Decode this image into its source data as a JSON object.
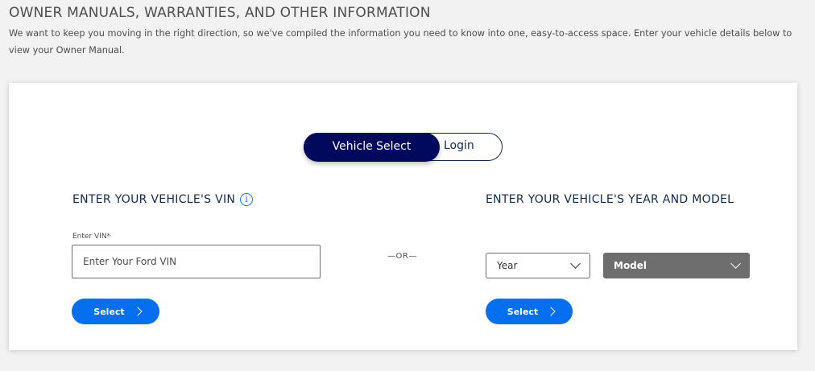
{
  "header": {
    "title": "OWNER MANUALS, WARRANTIES, AND OTHER INFORMATION",
    "description": "We want to keep you moving in the right direction, so we've compiled the information you need to know into one, easy-to-access space. Enter your vehicle details below to view your Owner Manual."
  },
  "toggle": {
    "active_label": "Vehicle Select",
    "inactive_label": "Login"
  },
  "vin_section": {
    "heading": "ENTER YOUR VEHICLE'S VIN",
    "info_icon": "i",
    "field_label": "Enter VIN*",
    "placeholder": "Enter Your Ford VIN",
    "button_label": "Select"
  },
  "divider": {
    "text": "—OR—"
  },
  "year_model_section": {
    "heading": "ENTER YOUR VEHICLE'S YEAR AND MODEL",
    "year_label": "Year",
    "model_label": "Model",
    "button_label": "Select"
  },
  "colors": {
    "brand_navy": "#00095b",
    "button_blue": "#066fef",
    "disabled_gray": "#6e6e6e"
  }
}
